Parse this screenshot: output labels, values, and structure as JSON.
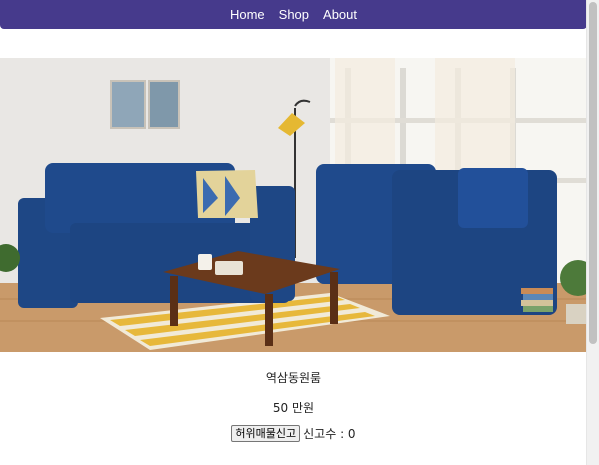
{
  "nav": {
    "items": [
      {
        "label": "Home"
      },
      {
        "label": "Shop"
      },
      {
        "label": "About"
      }
    ]
  },
  "product": {
    "name": "역삼동원룸",
    "price": "50 만원",
    "report_button_label": "허위매물신고",
    "report_count_label": "신고수 : 0"
  },
  "colors": {
    "navbar": "#463a8c",
    "sofa": "#1f4a8c"
  }
}
